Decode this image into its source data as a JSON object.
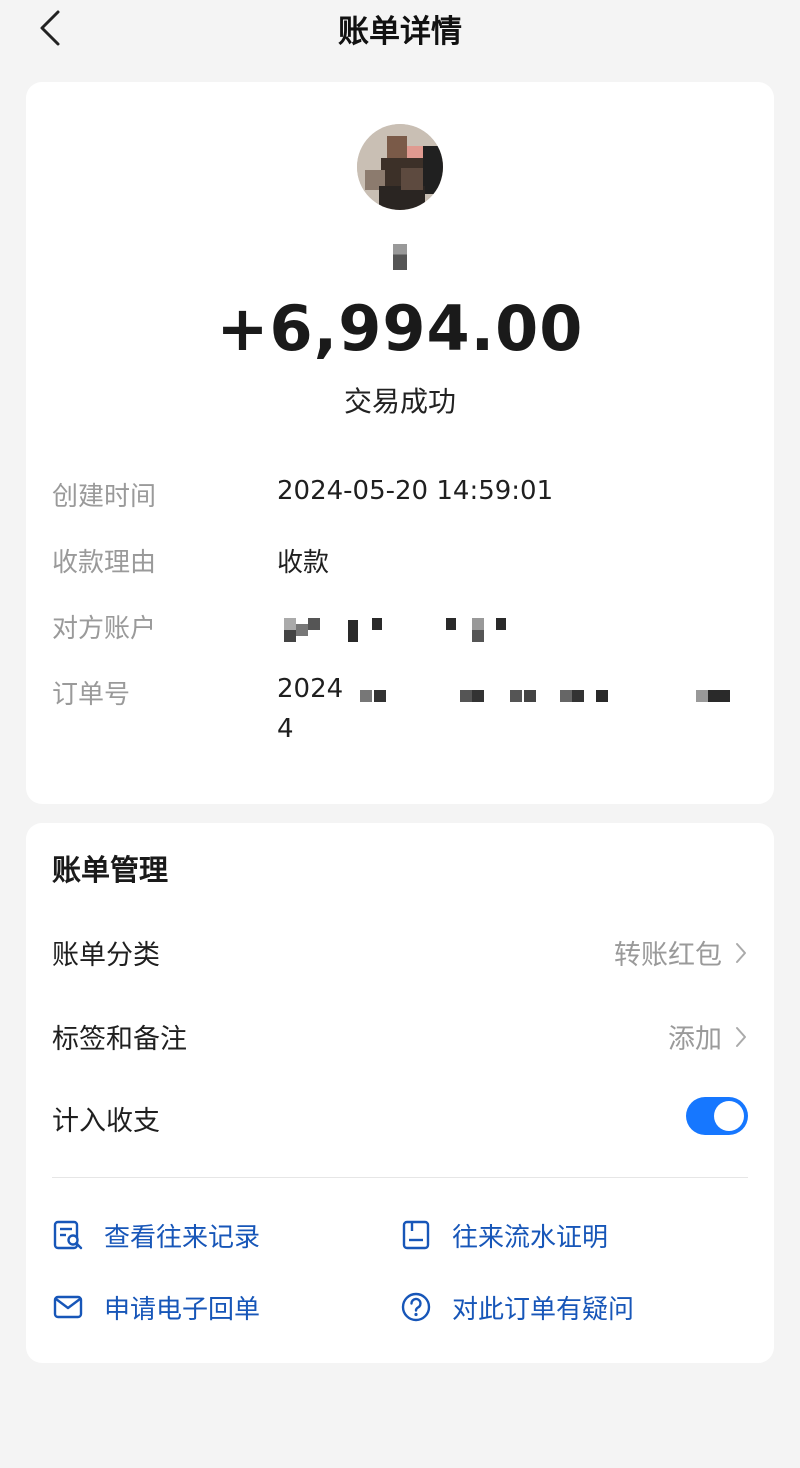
{
  "header": {
    "title": "账单详情",
    "back_icon": "chevron-left-icon"
  },
  "transaction": {
    "amount": "+6,994.00",
    "status": "交易成功"
  },
  "details": [
    {
      "label": "创建时间",
      "value": "2024-05-20 14:59:01"
    },
    {
      "label": "收款理由",
      "value": "收款"
    },
    {
      "label": "对方账户",
      "value": ""
    },
    {
      "label": "订单号",
      "value_prefix": "2024",
      "value_suffix": "4"
    }
  ],
  "management": {
    "title": "账单管理",
    "rows": [
      {
        "label": "账单分类",
        "value": "转账红包"
      },
      {
        "label": "标签和备注",
        "value": "添加"
      },
      {
        "label": "计入收支",
        "toggle_on": true
      }
    ],
    "actions": [
      {
        "label": "查看往来记录",
        "icon": "records-search-icon"
      },
      {
        "label": "往来流水证明",
        "icon": "statement-icon"
      },
      {
        "label": "申请电子回单",
        "icon": "mail-icon"
      },
      {
        "label": "对此订单有疑问",
        "icon": "question-icon"
      }
    ]
  },
  "colors": {
    "accent": "#1677ff",
    "link": "#1756b8",
    "background": "#f4f4f4",
    "muted_text": "#9a9a9a"
  }
}
